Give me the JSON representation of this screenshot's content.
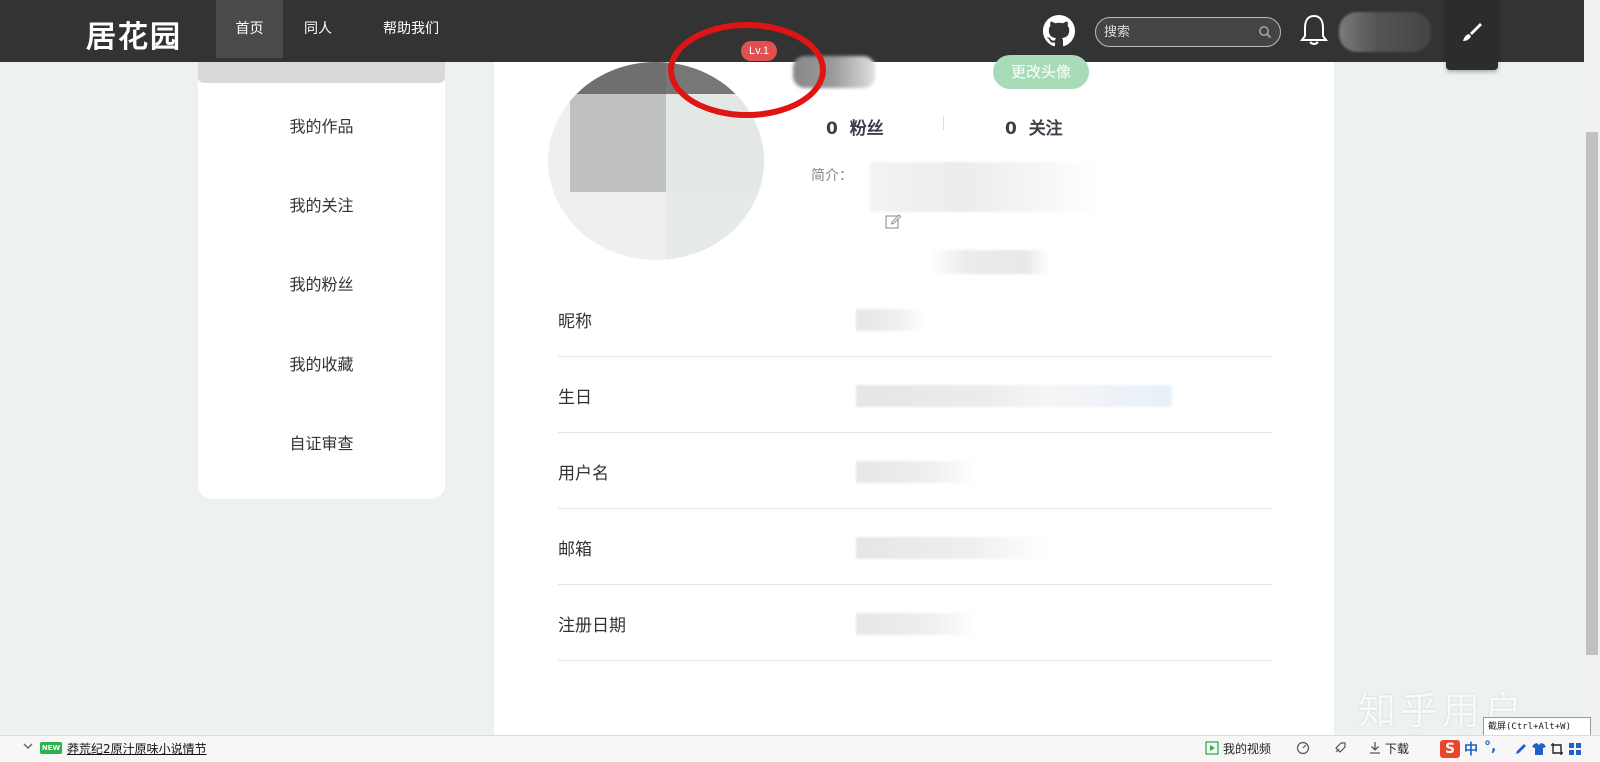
{
  "nav": {
    "logo": "居花园",
    "items": [
      {
        "label": "首页",
        "active": true
      },
      {
        "label": "同人",
        "active": false
      },
      {
        "label": "帮助我们",
        "active": false
      }
    ],
    "search_placeholder": "搜索",
    "icons": [
      "github-icon",
      "search-icon",
      "bell-icon",
      "brush-icon"
    ]
  },
  "sidebar": {
    "items": [
      {
        "label": "我的作品"
      },
      {
        "label": "我的关注"
      },
      {
        "label": "我的粉丝"
      },
      {
        "label": "我的收藏"
      },
      {
        "label": "自证审查"
      }
    ]
  },
  "profile": {
    "level": "Lv.1",
    "change_avatar_label": "更改头像",
    "fans_count": "0",
    "fans_label": "粉丝",
    "follow_count": "0",
    "follow_label": "关注",
    "bio_label": "简介："
  },
  "info": {
    "rows": [
      {
        "label": "昵称"
      },
      {
        "label": "生日"
      },
      {
        "label": "用户名"
      },
      {
        "label": "邮箱"
      },
      {
        "label": "注册日期"
      }
    ]
  },
  "watermark": "知乎用户",
  "taskbar": {
    "new_badge": "NEW",
    "news": "莽荒纪2原汁原味小说情节",
    "my_video": "我的视频",
    "download": "下载",
    "tooltip": "截屏(Ctrl+Alt+W)",
    "ime_zh": "中"
  },
  "colors": {
    "nav_bg": "#333333",
    "page_bg": "#edf2f1",
    "accent_green": "#a8dcb9",
    "badge_red": "#e05050",
    "annotation_red": "#e01414"
  }
}
